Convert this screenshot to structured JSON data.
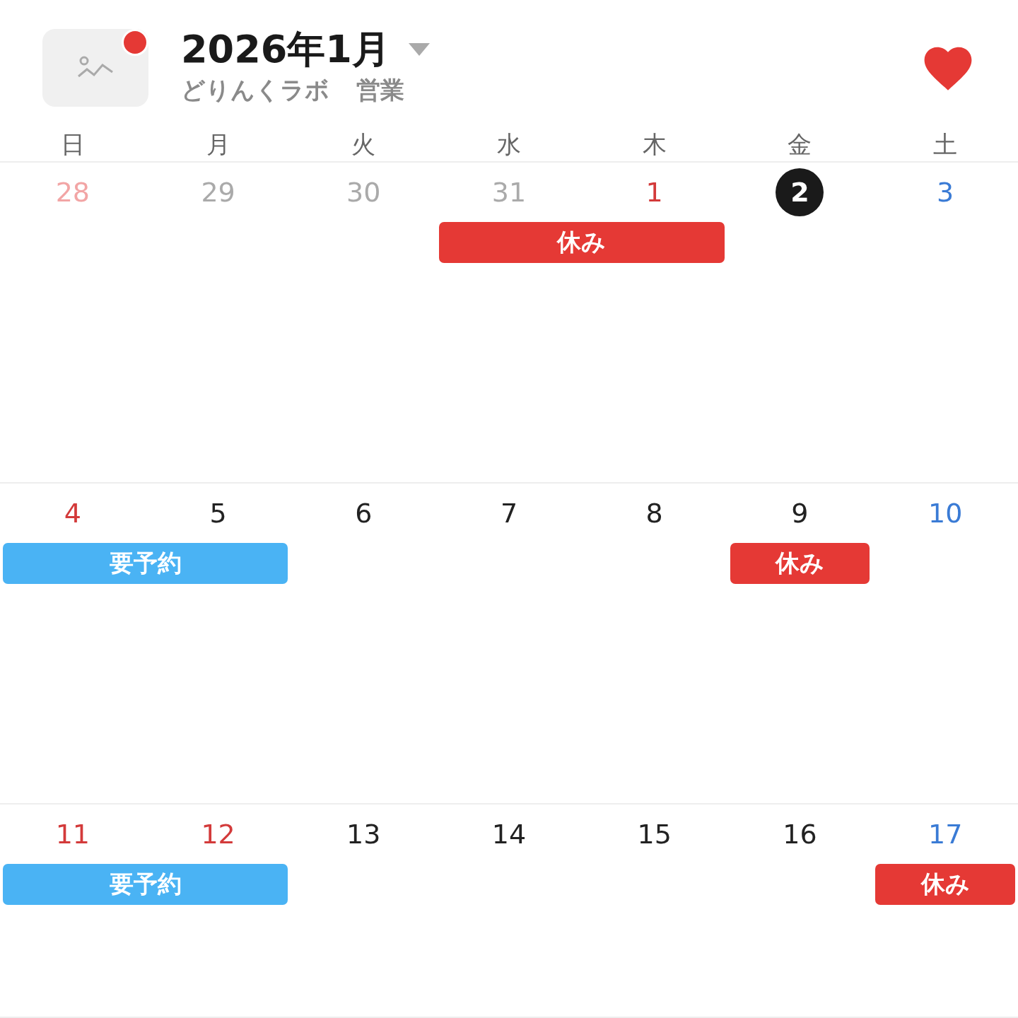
{
  "header": {
    "has_notification": true,
    "title": "2026年1月",
    "subtitle": [
      "どりんくラボ",
      "営業"
    ],
    "favorite": true
  },
  "weekdays": [
    "日",
    "月",
    "火",
    "水",
    "木",
    "金",
    "土"
  ],
  "weeks": [
    {
      "days": [
        {
          "label": "28",
          "kind": "outside_holiday"
        },
        {
          "label": "29",
          "kind": "outside"
        },
        {
          "label": "30",
          "kind": "outside"
        },
        {
          "label": "31",
          "kind": "outside"
        },
        {
          "label": "1",
          "kind": "holiday"
        },
        {
          "label": "2",
          "kind": "today"
        },
        {
          "label": "3",
          "kind": "saturday"
        }
      ],
      "lane": [
        {
          "kind": "blank"
        },
        {
          "kind": "blank"
        },
        {
          "kind": "blank"
        },
        {
          "kind": "closed",
          "label": "休み",
          "wide": true
        },
        {
          "kind": "blank"
        },
        {
          "kind": "blank"
        }
      ]
    },
    {
      "days": [
        {
          "label": "4",
          "kind": "holiday"
        },
        {
          "label": "5",
          "kind": "normal"
        },
        {
          "label": "6",
          "kind": "normal"
        },
        {
          "label": "7",
          "kind": "normal"
        },
        {
          "label": "8",
          "kind": "normal"
        },
        {
          "label": "9",
          "kind": "normal"
        },
        {
          "label": "10",
          "kind": "saturday"
        }
      ],
      "lane": [
        {
          "kind": "reservation",
          "label": "要予約",
          "wide": true
        },
        {
          "kind": "blank"
        },
        {
          "kind": "blank"
        },
        {
          "kind": "blank"
        },
        {
          "kind": "closed",
          "label": "休み",
          "wide": false
        },
        {
          "kind": "blank"
        }
      ]
    },
    {
      "days": [
        {
          "label": "11",
          "kind": "holiday"
        },
        {
          "label": "12",
          "kind": "holiday"
        },
        {
          "label": "13",
          "kind": "normal"
        },
        {
          "label": "14",
          "kind": "normal"
        },
        {
          "label": "15",
          "kind": "normal"
        },
        {
          "label": "16",
          "kind": "normal"
        },
        {
          "label": "17",
          "kind": "saturday"
        }
      ],
      "lane": [
        {
          "kind": "reservation",
          "label": "要予約",
          "wide": true
        },
        {
          "kind": "blank"
        },
        {
          "kind": "blank"
        },
        {
          "kind": "blank"
        },
        {
          "kind": "blank"
        },
        {
          "kind": "closed",
          "label": "休み",
          "wide": false
        }
      ]
    }
  ]
}
